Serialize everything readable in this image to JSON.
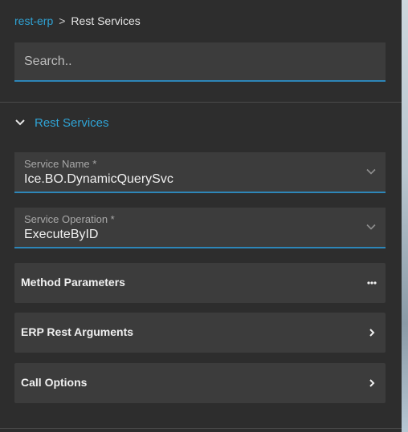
{
  "breadcrumb": {
    "root": "rest-erp",
    "separator": ">",
    "current": "Rest Services"
  },
  "search": {
    "placeholder": "Search..",
    "value": ""
  },
  "section": {
    "title": "Rest Services",
    "expanded": true
  },
  "fields": [
    {
      "label": "Service Name *",
      "value": "Ice.BO.DynamicQuerySvc"
    },
    {
      "label": "Service Operation *",
      "value": "ExecuteByID"
    }
  ],
  "rows": [
    {
      "label": "Method Parameters",
      "icon": "more-horizontal-icon"
    },
    {
      "label": "ERP Rest Arguments",
      "icon": "chevron-right-icon"
    },
    {
      "label": "Call Options",
      "icon": "chevron-right-icon"
    }
  ],
  "colors": {
    "accent": "#2fa4d6",
    "panel": "#2d2d2d",
    "field": "#3c3c3c",
    "underline": "#2d86b8"
  }
}
